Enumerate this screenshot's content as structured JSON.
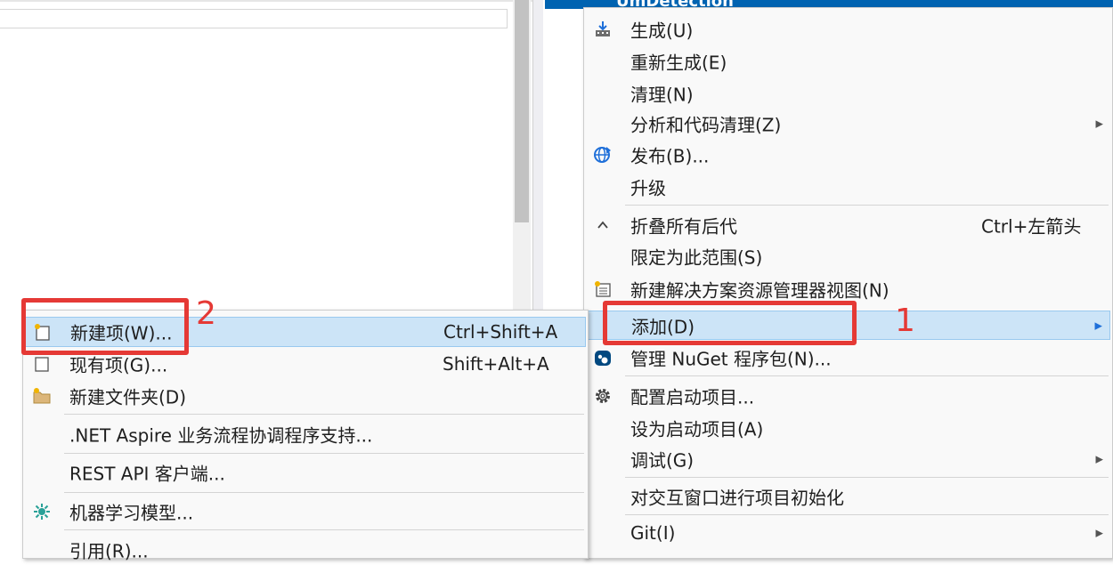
{
  "solution_explorer": {
    "selected_node": "UmDetection"
  },
  "main_menu": {
    "items": [
      {
        "label": "生成(U)",
        "icon": "build-icon"
      },
      {
        "label": "重新生成(E)"
      },
      {
        "label": "清理(N)"
      },
      {
        "label": "分析和代码清理(Z)",
        "submenu": true
      },
      {
        "label": "发布(B)...",
        "icon": "publish-globe-icon"
      },
      {
        "label": "升级"
      },
      {
        "label": "折叠所有后代",
        "shortcut": "Ctrl+左箭头",
        "icon": "collapse-chevron-icon"
      },
      {
        "label": "限定为此范围(S)"
      },
      {
        "label": "新建解决方案资源管理器视图(N)",
        "icon": "new-view-icon"
      },
      {
        "label": "添加(D)",
        "submenu": true,
        "highlighted": true
      },
      {
        "label": "管理 NuGet 程序包(N)...",
        "icon": "nuget-icon"
      },
      {
        "label": "配置启动项目...",
        "icon": "gear-icon"
      },
      {
        "label": "设为启动项目(A)"
      },
      {
        "label": "调试(G)",
        "submenu": true
      },
      {
        "label": "对交互窗口进行项目初始化"
      },
      {
        "label": "Git(I)",
        "submenu": true
      }
    ]
  },
  "add_submenu": {
    "items": [
      {
        "label": "新建项(W)...",
        "shortcut": "Ctrl+Shift+A",
        "icon": "new-item-icon",
        "highlighted": true
      },
      {
        "label": "现有项(G)...",
        "shortcut": "Shift+Alt+A",
        "icon": "existing-item-icon"
      },
      {
        "label": "新建文件夹(D)",
        "icon": "new-folder-icon"
      },
      {
        "label": ".NET Aspire 业务流程协调程序支持..."
      },
      {
        "label": "REST API 客户端..."
      },
      {
        "label": "机器学习模型...",
        "icon": "ml-model-icon"
      },
      {
        "label": "引用(R)..."
      }
    ]
  },
  "annotations": {
    "step1": "1",
    "step2": "2",
    "color": "#e53935"
  },
  "colors": {
    "highlight_bg": "#cce4f7",
    "highlight_border": "#99c9ef",
    "selected_node_bg": "#0063b1"
  }
}
